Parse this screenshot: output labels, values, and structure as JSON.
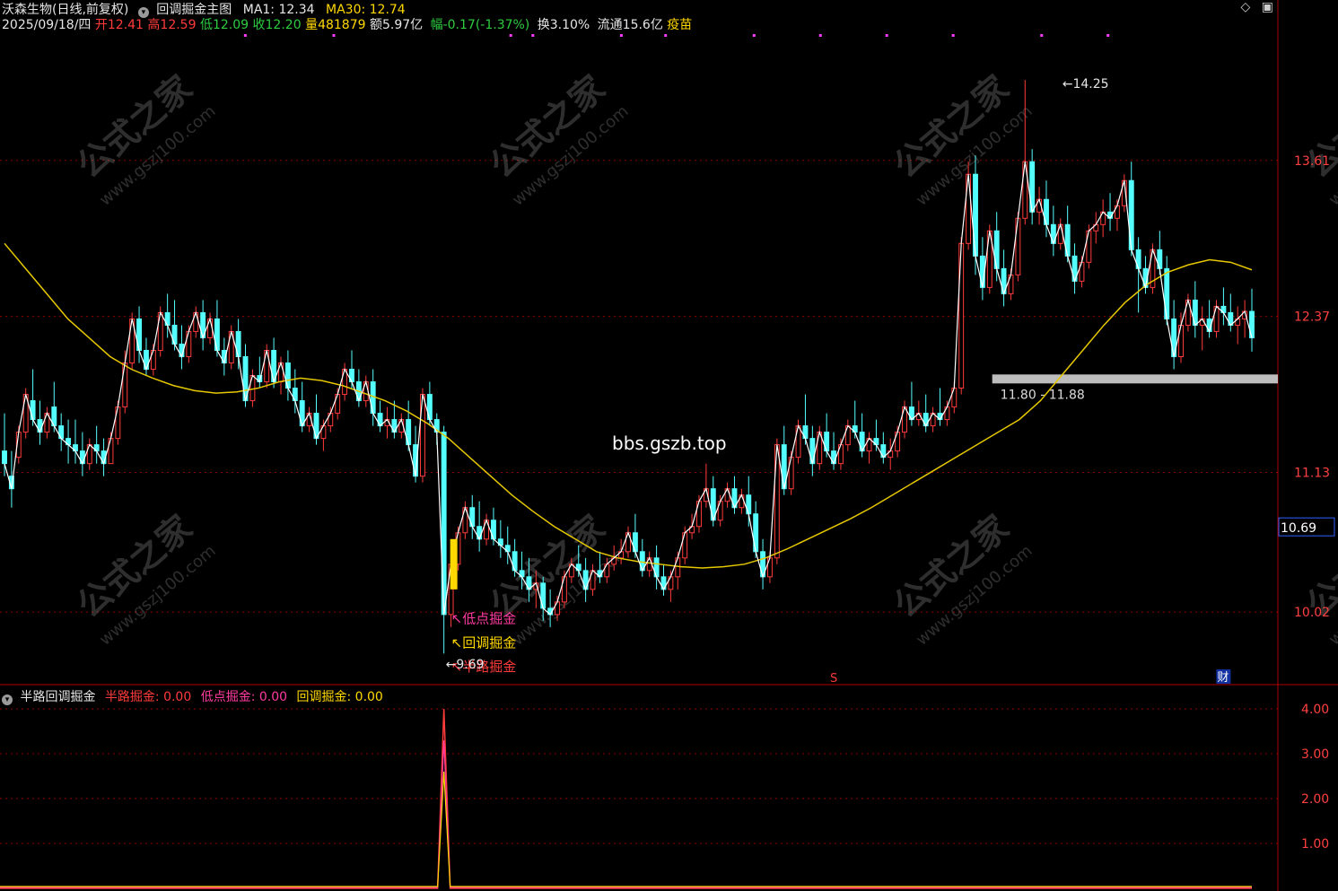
{
  "header": {
    "stock_name": "沃森生物(日线,前复权)",
    "indicator": "回调掘金主图",
    "ma1_label": "MA1: 12.34",
    "ma30_label": "MA30: 12.74",
    "date": "2025/09/18/四",
    "open_label": "开",
    "open": "12.41",
    "high_label": "高",
    "high": "12.59",
    "low_label": "低",
    "low": "12.09",
    "close_label": "收",
    "close": "12.20",
    "vol_label": "量",
    "vol": "481879",
    "amount": "额5.97亿",
    "change_label": "幅",
    "change": "-0.17(-1.37%)",
    "turnover": "换3.10%",
    "float": "流通15.6亿",
    "concept": "疫苗"
  },
  "top_icons": [
    "diamond-icon",
    "window-icon"
  ],
  "watermark": {
    "text": "公式之家",
    "url": "www.gszj100.com"
  },
  "site_text": "bbs.gszb.top",
  "marker_s": "S",
  "marker_cai": "财",
  "annotations": {
    "low_buy": "低点掘金",
    "pullback": "回调掘金",
    "halfway": "半路掘金",
    "min_price": "9.69",
    "max_price": "14.25",
    "zone": "11.80 - 11.88"
  },
  "price_axis": {
    "ticks": [
      "13.61",
      "12.37",
      "11.13",
      "10.02"
    ],
    "current": "10.69"
  },
  "subpanel": {
    "title": "半路回调掘金",
    "s1_label": "半路掘金",
    "s1_value": ": 0.00",
    "s2_label": "低点掘金",
    "s2_value": ": 0.00",
    "s3_label": "回调掘金",
    "s3_value": ": 0.00",
    "ticks": [
      "4.00",
      "3.00",
      "2.00",
      "1.00"
    ]
  },
  "colors": {
    "up": "#ff3b3b",
    "down": "#54ffff",
    "ma1": "#ffffff",
    "ma30": "#e6c800",
    "grid": "#8b0000"
  },
  "chart_data": {
    "type": "candlestick",
    "candles": [
      [
        11.3,
        11.6,
        11.2,
        11.1
      ],
      [
        11.1,
        11.3,
        11.0,
        10.85
      ],
      [
        11.25,
        11.5,
        11.45,
        11.2
      ],
      [
        11.45,
        11.8,
        11.75,
        11.4
      ],
      [
        11.7,
        11.95,
        11.55,
        11.5
      ],
      [
        11.55,
        11.7,
        11.45,
        11.35
      ],
      [
        11.45,
        11.65,
        11.6,
        11.4
      ],
      [
        11.65,
        11.85,
        11.5,
        11.45
      ],
      [
        11.5,
        11.6,
        11.4,
        11.3
      ],
      [
        11.4,
        11.55,
        11.35,
        11.2
      ],
      [
        11.35,
        11.55,
        11.3,
        11.2
      ],
      [
        11.3,
        11.45,
        11.2,
        11.1
      ],
      [
        11.2,
        11.4,
        11.35,
        11.15
      ],
      [
        11.35,
        11.5,
        11.3,
        11.2
      ],
      [
        11.3,
        11.4,
        11.2,
        11.1
      ],
      [
        11.2,
        11.45,
        11.4,
        11.2
      ],
      [
        11.4,
        11.7,
        11.65,
        11.35
      ],
      [
        11.65,
        12.1,
        12.0,
        11.6
      ],
      [
        12.0,
        12.4,
        12.35,
        11.95
      ],
      [
        12.35,
        12.45,
        12.1,
        12.0
      ],
      [
        12.1,
        12.2,
        11.95,
        11.9
      ],
      [
        11.95,
        12.15,
        12.1,
        11.9
      ],
      [
        12.1,
        12.45,
        12.4,
        12.05
      ],
      [
        12.4,
        12.55,
        12.3,
        12.2
      ],
      [
        12.3,
        12.5,
        12.15,
        12.1
      ],
      [
        12.15,
        12.3,
        12.05,
        11.95
      ],
      [
        12.05,
        12.3,
        12.25,
        12.0
      ],
      [
        12.25,
        12.45,
        12.4,
        12.2
      ],
      [
        12.4,
        12.5,
        12.2,
        12.1
      ],
      [
        12.2,
        12.4,
        12.35,
        12.15
      ],
      [
        12.35,
        12.5,
        12.1,
        12.05
      ],
      [
        12.1,
        12.2,
        12.0,
        11.9
      ],
      [
        12.0,
        12.3,
        12.25,
        11.95
      ],
      [
        12.25,
        12.35,
        12.05,
        11.95
      ],
      [
        12.05,
        12.15,
        11.7,
        11.65
      ],
      [
        11.7,
        11.95,
        11.9,
        11.65
      ],
      [
        11.9,
        12.05,
        11.85,
        11.8
      ],
      [
        11.85,
        12.15,
        12.1,
        11.8
      ],
      [
        12.1,
        12.2,
        11.85,
        11.8
      ],
      [
        11.85,
        12.05,
        12.0,
        11.75
      ],
      [
        12.0,
        12.1,
        11.8,
        11.7
      ],
      [
        11.8,
        11.95,
        11.7,
        11.6
      ],
      [
        11.7,
        11.85,
        11.5,
        11.45
      ],
      [
        11.5,
        11.65,
        11.6,
        11.45
      ],
      [
        11.6,
        11.75,
        11.4,
        11.35
      ],
      [
        11.4,
        11.55,
        11.5,
        11.3
      ],
      [
        11.5,
        11.65,
        11.6,
        11.45
      ],
      [
        11.6,
        11.8,
        11.75,
        11.55
      ],
      [
        11.75,
        12.0,
        11.95,
        11.7
      ],
      [
        11.95,
        12.1,
        11.85,
        11.8
      ],
      [
        11.85,
        11.95,
        11.7,
        11.65
      ],
      [
        11.7,
        11.9,
        11.85,
        11.65
      ],
      [
        11.85,
        11.95,
        11.6,
        11.5
      ],
      [
        11.6,
        11.7,
        11.5,
        11.45
      ],
      [
        11.5,
        11.65,
        11.55,
        11.4
      ],
      [
        11.55,
        11.7,
        11.45,
        11.4
      ],
      [
        11.45,
        11.6,
        11.55,
        11.4
      ],
      [
        11.55,
        11.7,
        11.35,
        11.3
      ],
      [
        11.35,
        11.5,
        11.1,
        11.05
      ],
      [
        11.1,
        11.8,
        11.75,
        11.05
      ],
      [
        11.75,
        11.85,
        11.55,
        11.5
      ],
      [
        11.55,
        11.6,
        11.45,
        11.35
      ],
      [
        11.45,
        11.5,
        10.0,
        9.69
      ],
      [
        10.0,
        10.45,
        10.4,
        9.9
      ],
      [
        10.4,
        10.7,
        10.65,
        10.35
      ],
      [
        10.65,
        10.9,
        10.85,
        10.6
      ],
      [
        10.85,
        10.95,
        10.7,
        10.6
      ],
      [
        10.7,
        10.9,
        10.6,
        10.5
      ],
      [
        10.6,
        10.8,
        10.75,
        10.55
      ],
      [
        10.75,
        10.85,
        10.6,
        10.55
      ],
      [
        10.6,
        10.75,
        10.55,
        10.45
      ],
      [
        10.55,
        10.7,
        10.5,
        10.4
      ],
      [
        10.5,
        10.6,
        10.35,
        10.3
      ],
      [
        10.35,
        10.5,
        10.3,
        10.2
      ],
      [
        10.3,
        10.45,
        10.2,
        10.1
      ],
      [
        10.2,
        10.35,
        10.25,
        10.05
      ],
      [
        10.25,
        10.3,
        10.05,
        9.95
      ],
      [
        10.05,
        10.2,
        10.0,
        9.9
      ],
      [
        10.0,
        10.15,
        10.1,
        9.95
      ],
      [
        10.1,
        10.35,
        10.3,
        10.05
      ],
      [
        10.3,
        10.45,
        10.4,
        10.25
      ],
      [
        10.4,
        10.55,
        10.35,
        10.3
      ],
      [
        10.35,
        10.45,
        10.2,
        10.1
      ],
      [
        10.2,
        10.4,
        10.35,
        10.15
      ],
      [
        10.35,
        10.5,
        10.3,
        10.25
      ],
      [
        10.3,
        10.45,
        10.4,
        10.25
      ],
      [
        10.4,
        10.55,
        10.45,
        10.35
      ],
      [
        10.45,
        10.6,
        10.5,
        10.4
      ],
      [
        10.5,
        10.7,
        10.65,
        10.45
      ],
      [
        10.65,
        10.8,
        10.5,
        10.45
      ],
      [
        10.5,
        10.6,
        10.35,
        10.3
      ],
      [
        10.35,
        10.5,
        10.45,
        10.3
      ],
      [
        10.45,
        10.55,
        10.3,
        10.2
      ],
      [
        10.3,
        10.4,
        10.2,
        10.15
      ],
      [
        10.2,
        10.35,
        10.3,
        10.1
      ],
      [
        10.3,
        10.5,
        10.45,
        10.2
      ],
      [
        10.45,
        10.7,
        10.65,
        10.4
      ],
      [
        10.65,
        10.8,
        10.7,
        10.6
      ],
      [
        10.7,
        10.95,
        10.9,
        10.65
      ],
      [
        10.9,
        11.2,
        11.0,
        10.85
      ],
      [
        11.0,
        11.1,
        10.75,
        10.7
      ],
      [
        10.75,
        10.95,
        10.9,
        10.7
      ],
      [
        10.9,
        11.05,
        11.0,
        10.85
      ],
      [
        11.0,
        11.1,
        10.85,
        10.8
      ],
      [
        10.85,
        11.0,
        10.95,
        10.8
      ],
      [
        10.95,
        11.1,
        10.8,
        10.7
      ],
      [
        10.8,
        10.9,
        10.5,
        10.45
      ],
      [
        10.5,
        10.6,
        10.3,
        10.2
      ],
      [
        10.3,
        10.5,
        10.45,
        10.25
      ],
      [
        10.45,
        11.4,
        11.35,
        10.4
      ],
      [
        11.35,
        11.5,
        11.0,
        10.95
      ],
      [
        11.0,
        11.3,
        11.25,
        10.95
      ],
      [
        11.25,
        11.55,
        11.5,
        11.2
      ],
      [
        11.5,
        11.75,
        11.4,
        11.35
      ],
      [
        11.4,
        11.5,
        11.2,
        11.1
      ],
      [
        11.2,
        11.5,
        11.45,
        11.15
      ],
      [
        11.45,
        11.6,
        11.3,
        11.25
      ],
      [
        11.3,
        11.45,
        11.2,
        11.15
      ],
      [
        11.2,
        11.4,
        11.35,
        11.15
      ],
      [
        11.35,
        11.55,
        11.5,
        11.3
      ],
      [
        11.5,
        11.7,
        11.45,
        11.4
      ],
      [
        11.45,
        11.6,
        11.3,
        11.25
      ],
      [
        11.3,
        11.45,
        11.4,
        11.2
      ],
      [
        11.4,
        11.55,
        11.35,
        11.3
      ],
      [
        11.35,
        11.45,
        11.25,
        11.2
      ],
      [
        11.25,
        11.4,
        11.3,
        11.15
      ],
      [
        11.3,
        11.5,
        11.45,
        11.25
      ],
      [
        11.45,
        11.7,
        11.65,
        11.4
      ],
      [
        11.65,
        11.85,
        11.55,
        11.5
      ],
      [
        11.55,
        11.7,
        11.6,
        11.5
      ],
      [
        11.6,
        11.75,
        11.5,
        11.45
      ],
      [
        11.5,
        11.65,
        11.6,
        11.45
      ],
      [
        11.6,
        11.8,
        11.55,
        11.5
      ],
      [
        11.55,
        11.7,
        11.65,
        11.5
      ],
      [
        11.65,
        11.85,
        11.8,
        11.6
      ],
      [
        11.8,
        13.0,
        12.95,
        11.75
      ],
      [
        12.95,
        13.6,
        13.5,
        12.9
      ],
      [
        13.5,
        13.65,
        12.85,
        12.7
      ],
      [
        12.85,
        13.0,
        12.6,
        12.5
      ],
      [
        12.6,
        13.1,
        13.05,
        12.55
      ],
      [
        13.05,
        13.2,
        12.75,
        12.65
      ],
      [
        12.75,
        12.9,
        12.55,
        12.45
      ],
      [
        12.55,
        12.75,
        12.7,
        12.5
      ],
      [
        12.7,
        13.2,
        13.15,
        12.65
      ],
      [
        13.15,
        14.25,
        13.6,
        13.1
      ],
      [
        13.6,
        13.7,
        13.2,
        13.1
      ],
      [
        13.2,
        13.4,
        13.3,
        13.1
      ],
      [
        13.3,
        13.45,
        13.1,
        13.0
      ],
      [
        13.1,
        13.25,
        12.95,
        12.85
      ],
      [
        12.95,
        13.15,
        13.1,
        12.9
      ],
      [
        13.1,
        13.25,
        12.85,
        12.8
      ],
      [
        12.85,
        12.95,
        12.65,
        12.55
      ],
      [
        12.65,
        12.85,
        12.8,
        12.6
      ],
      [
        12.8,
        13.1,
        13.05,
        12.75
      ],
      [
        13.05,
        13.2,
        13.1,
        12.95
      ],
      [
        13.1,
        13.3,
        13.2,
        13.0
      ],
      [
        13.2,
        13.35,
        13.15,
        13.05
      ],
      [
        13.15,
        13.3,
        13.25,
        13.05
      ],
      [
        13.25,
        13.5,
        13.45,
        13.2
      ],
      [
        13.45,
        13.6,
        12.9,
        12.85
      ],
      [
        12.9,
        13.0,
        12.75,
        12.4
      ],
      [
        12.75,
        12.85,
        12.6,
        12.55
      ],
      [
        12.6,
        12.95,
        12.9,
        12.55
      ],
      [
        12.9,
        13.05,
        12.75,
        12.7
      ],
      [
        12.75,
        12.85,
        12.35,
        12.3
      ],
      [
        12.35,
        12.5,
        12.05,
        11.95
      ],
      [
        12.05,
        12.4,
        12.3,
        12.0
      ],
      [
        12.3,
        12.55,
        12.5,
        12.25
      ],
      [
        12.5,
        12.65,
        12.3,
        12.2
      ],
      [
        12.3,
        12.45,
        12.35,
        12.1
      ],
      [
        12.35,
        12.5,
        12.25,
        12.2
      ],
      [
        12.25,
        12.5,
        12.45,
        12.2
      ],
      [
        12.45,
        12.6,
        12.4,
        12.3
      ],
      [
        12.4,
        12.55,
        12.3,
        12.25
      ],
      [
        12.3,
        12.45,
        12.35,
        12.15
      ],
      [
        12.35,
        12.5,
        12.41,
        12.2
      ],
      [
        12.41,
        12.59,
        12.2,
        12.09
      ]
    ],
    "ma1_desc": "close",
    "ma30": [
      12.95,
      12.75,
      12.55,
      12.35,
      12.2,
      12.05,
      11.95,
      11.88,
      11.82,
      11.78,
      11.76,
      11.77,
      11.8,
      11.85,
      11.88,
      11.86,
      11.82,
      11.76,
      11.7,
      11.62,
      11.52,
      11.4,
      11.25,
      11.1,
      10.95,
      10.82,
      10.7,
      10.6,
      10.5,
      10.45,
      10.42,
      10.4,
      10.38,
      10.37,
      10.38,
      10.4,
      10.45,
      10.52,
      10.6,
      10.68,
      10.76,
      10.85,
      10.95,
      11.05,
      11.15,
      11.25,
      11.35,
      11.45,
      11.55,
      11.7,
      11.9,
      12.1,
      12.3,
      12.48,
      12.62,
      12.72,
      12.78,
      12.82,
      12.8,
      12.74
    ],
    "ylim": [
      9.45,
      14.6
    ],
    "zone_low": 11.8,
    "zone_high": 11.88,
    "indicator_series": {
      "name": "半路回调掘金",
      "spike_index": 62,
      "spike_value": 4.0
    },
    "sub_ylim": [
      0,
      4.4
    ]
  }
}
